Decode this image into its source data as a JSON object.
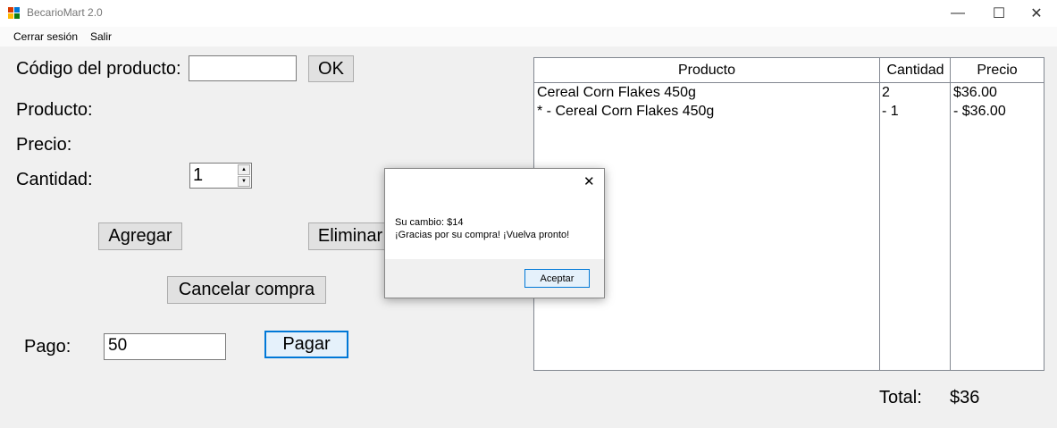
{
  "window": {
    "title": "BecarioMart 2.0",
    "minimize": "—",
    "maximize": "☐",
    "close": "✕"
  },
  "menu": {
    "items": [
      "Cerrar sesión",
      "Salir"
    ]
  },
  "form": {
    "codigo_label": "Código del producto:",
    "codigo_value": "",
    "ok_label": "OK",
    "producto_label": "Producto:",
    "precio_label": "Precio:",
    "cantidad_label": "Cantidad:",
    "cantidad_value": "1",
    "agregar_label": "Agregar",
    "eliminar_label": "Eliminar",
    "cancelar_label": "Cancelar compra",
    "pago_label": "Pago:",
    "pago_value": "50",
    "pagar_label": "Pagar"
  },
  "table": {
    "headers": [
      "Producto",
      "Cantidad",
      "Precio"
    ],
    "rows": [
      [
        "Cereal Corn Flakes 450g",
        "2",
        "$36.00"
      ],
      [
        "* - Cereal Corn Flakes 450g",
        "- 1",
        "- $36.00"
      ]
    ]
  },
  "total": {
    "label": "Total:",
    "value": "$36"
  },
  "dialog": {
    "line1": "Su cambio: $14",
    "line2": "¡Gracias por su compra! ¡Vuelva pronto!",
    "button": "Aceptar",
    "close": "✕"
  }
}
